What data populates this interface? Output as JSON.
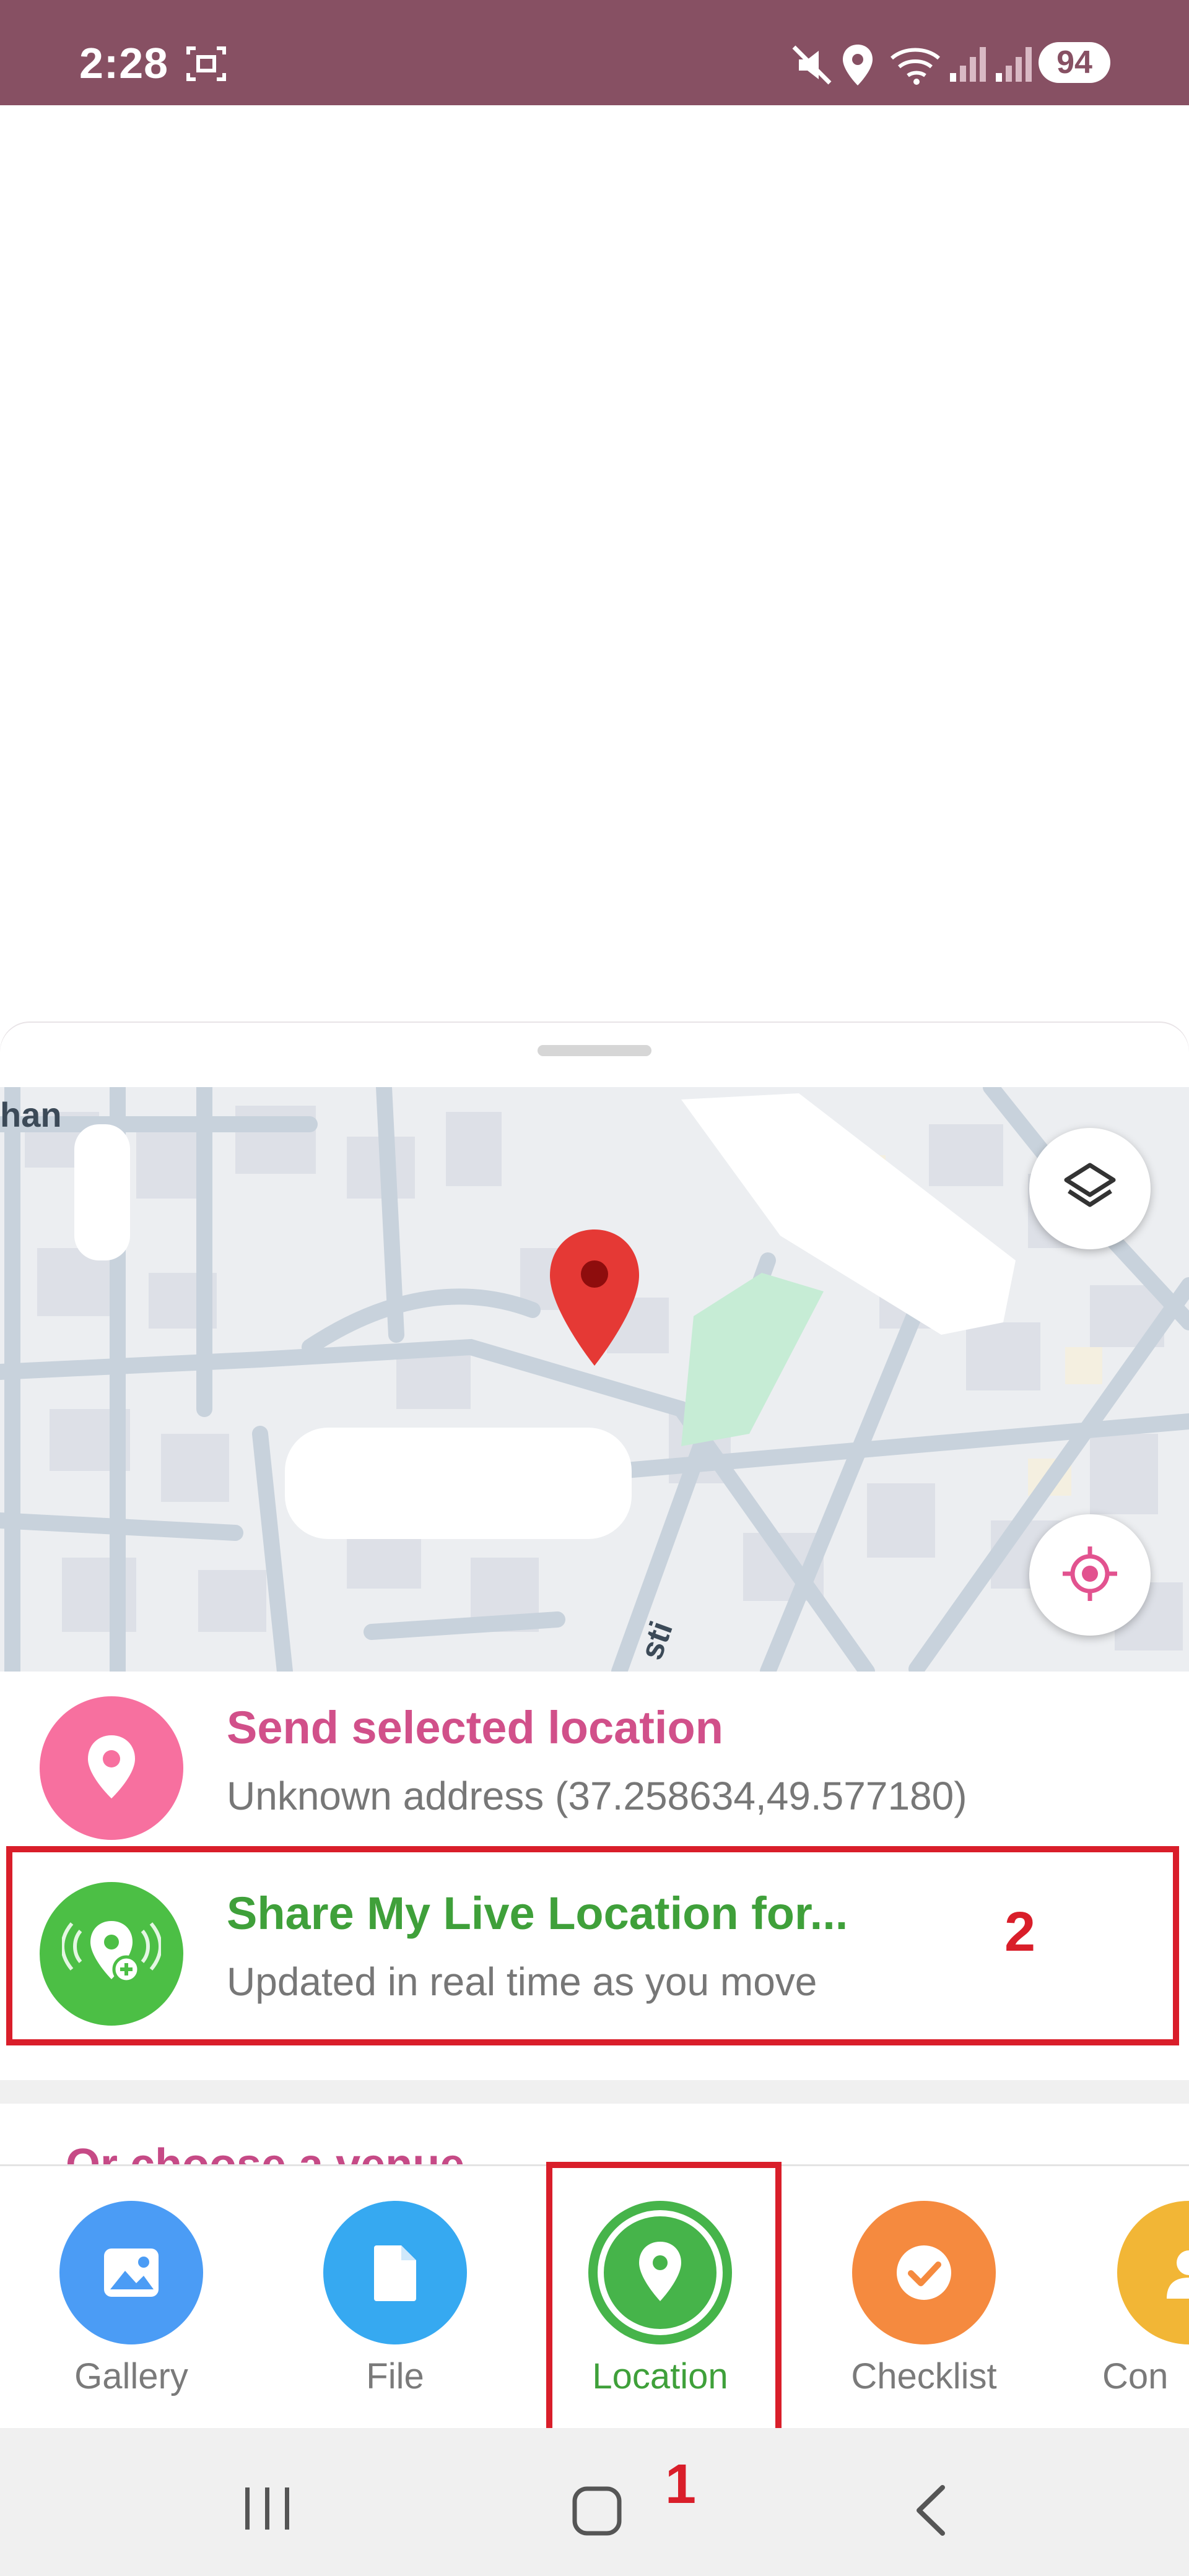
{
  "status_bar": {
    "time": "2:28",
    "battery": "94",
    "icons": [
      "screenshot-icon",
      "mute-icon",
      "location-icon",
      "wifi-icon",
      "signal-icon",
      "signal-icon"
    ],
    "bg_color": "#875063"
  },
  "map": {
    "labels": [
      "han",
      "sti"
    ],
    "pin_color": "#e53935"
  },
  "send_location": {
    "title": "Send selected location",
    "subtitle": "Unknown address (37.258634,49.577180)",
    "color": "#d1508a",
    "icon_bg": "#f7709f"
  },
  "live_location": {
    "title": "Share My Live Location for...",
    "subtitle": "Updated in real time as you move",
    "color": "#3fa03a",
    "icon_bg": "#4cbf45"
  },
  "venue_section": {
    "title": "Or choose a venue"
  },
  "attach_bar": {
    "items": [
      {
        "label": "Gallery",
        "color": "#4b9cf5",
        "icon": "gallery-icon"
      },
      {
        "label": "File",
        "color": "#36a9f1",
        "icon": "file-icon"
      },
      {
        "label": "Location",
        "color": "#46b44a",
        "icon": "location-icon",
        "selected": true
      },
      {
        "label": "Checklist",
        "color": "#f58a3f",
        "icon": "checklist-icon"
      },
      {
        "label": "Con",
        "color": "#f2b636",
        "icon": "contact-icon"
      }
    ]
  },
  "annotations": {
    "one": "1",
    "two": "2",
    "color": "#d91e2a"
  }
}
